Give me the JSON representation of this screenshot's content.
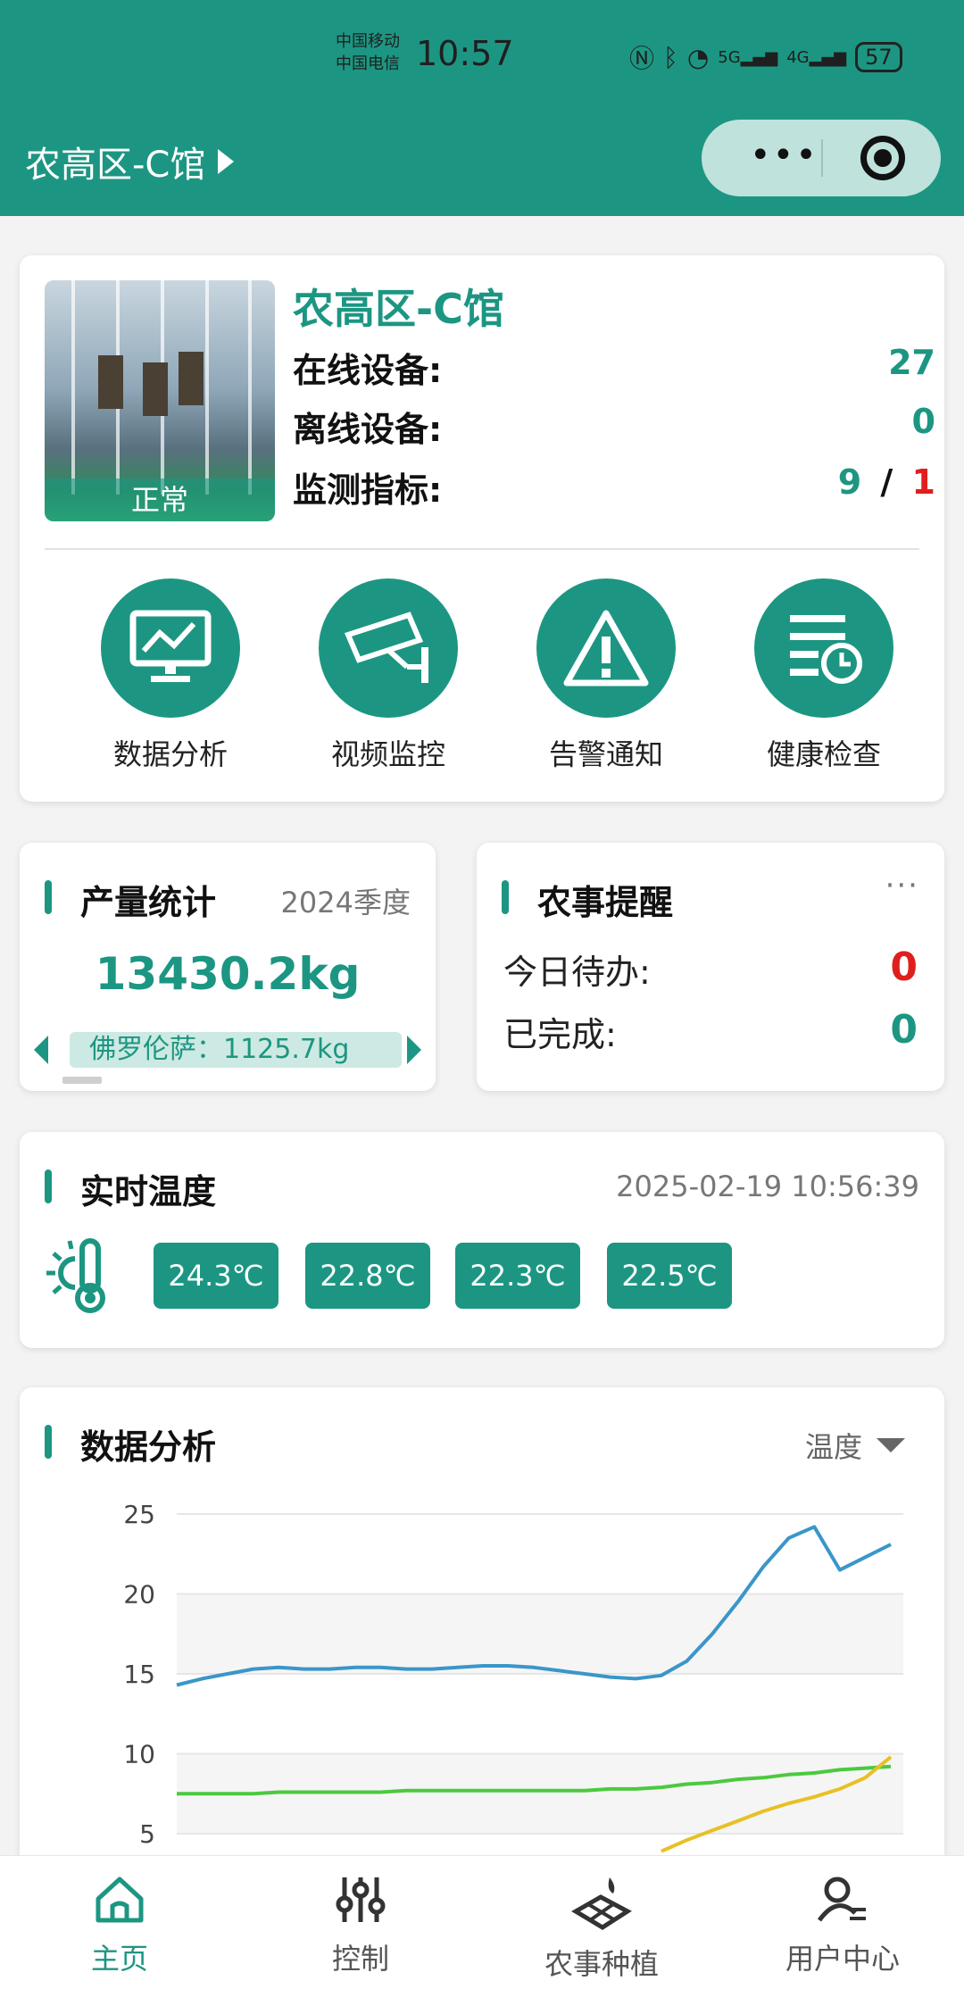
{
  "status_bar": {
    "carrier1": "中国移动",
    "carrier2": "中国电信",
    "time": "10:57",
    "network1": "5G",
    "network2": "4G",
    "battery": "57"
  },
  "header": {
    "location": "农高区-C馆"
  },
  "overview": {
    "site_name": "农高区-C馆",
    "image_status": "正常",
    "online_label": "在线设备:",
    "online_value": "27",
    "offline_label": "离线设备:",
    "offline_value": "0",
    "metrics_label": "监测指标:",
    "metrics_ok": "9",
    "metrics_sep": "/",
    "metrics_alert": "1",
    "shortcuts": [
      {
        "label": "数据分析",
        "icon": "monitor-chart-icon"
      },
      {
        "label": "视频监控",
        "icon": "cctv-camera-icon"
      },
      {
        "label": "告警通知",
        "icon": "warning-icon"
      },
      {
        "label": "健康检查",
        "icon": "checklist-clock-icon"
      }
    ]
  },
  "yield": {
    "title": "产量统计",
    "period": "2024季度",
    "total": "13430.2kg",
    "item": "佛罗伦萨：1125.7kg"
  },
  "farm_reminder": {
    "title": "农事提醒",
    "more": "···",
    "todo_label": "今日待办:",
    "todo_value": "0",
    "done_label": "已完成:",
    "done_value": "0"
  },
  "realtime_temp": {
    "title": "实时温度",
    "timestamp": "2025-02-19 10:56:39",
    "readings": [
      "24.3℃",
      "22.8℃",
      "22.3℃",
      "22.5℃"
    ]
  },
  "analysis": {
    "title": "数据分析",
    "selector": "温度"
  },
  "chart_data": {
    "type": "line",
    "ylim": [
      0,
      25
    ],
    "yticks": [
      "25",
      "20",
      "15",
      "10",
      "5"
    ],
    "series": [
      {
        "color": "#3a96c9",
        "values": [
          14.3,
          14.7,
          15.0,
          15.3,
          15.4,
          15.3,
          15.3,
          15.4,
          15.4,
          15.3,
          15.3,
          15.4,
          15.5,
          15.5,
          15.4,
          15.2,
          15.0,
          14.8,
          14.7,
          14.9,
          15.8,
          17.5,
          19.5,
          21.7,
          23.5,
          24.2,
          21.5,
          22.3,
          23.1
        ]
      },
      {
        "color": "#4cc93f",
        "values": [
          7.5,
          7.5,
          7.5,
          7.5,
          7.6,
          7.6,
          7.6,
          7.6,
          7.6,
          7.7,
          7.7,
          7.7,
          7.7,
          7.7,
          7.7,
          7.7,
          7.7,
          7.8,
          7.8,
          7.9,
          8.1,
          8.2,
          8.4,
          8.5,
          8.7,
          8.8,
          9.0,
          9.1,
          9.2
        ]
      },
      {
        "color": "#e8c023",
        "values": [
          null,
          null,
          null,
          null,
          null,
          null,
          null,
          null,
          null,
          null,
          null,
          null,
          null,
          null,
          null,
          null,
          null,
          null,
          null,
          3.9,
          4.6,
          5.2,
          5.8,
          6.4,
          6.9,
          7.3,
          7.8,
          8.5,
          9.8
        ]
      }
    ]
  },
  "tabbar": {
    "items": [
      {
        "label": "主页",
        "icon": "home-icon"
      },
      {
        "label": "控制",
        "icon": "sliders-icon"
      },
      {
        "label": "农事种植",
        "icon": "planting-icon"
      },
      {
        "label": "用户中心",
        "icon": "user-icon"
      }
    ]
  }
}
